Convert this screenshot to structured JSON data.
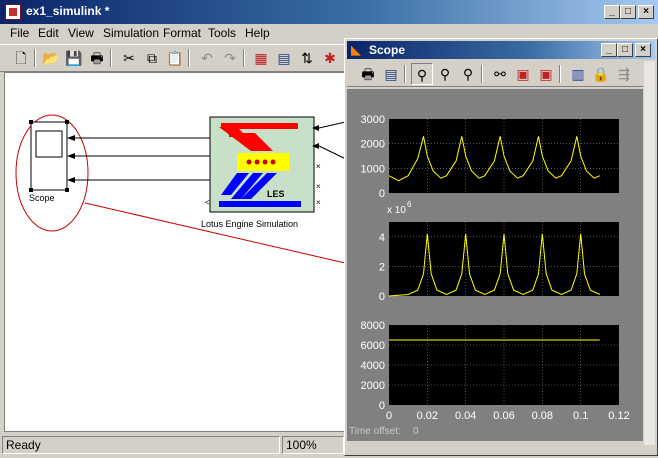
{
  "main_window": {
    "title": "ex1_simulink *",
    "menu": [
      "File",
      "Edit",
      "View",
      "Simulation",
      "Format",
      "Tools",
      "Help"
    ],
    "status": {
      "text": "Ready",
      "zoom": "100%"
    },
    "blocks": {
      "scope_label": "Scope",
      "les_badge": "LES",
      "les_label": "Lotus Engine Simulation"
    }
  },
  "scope_window": {
    "title": "Scope",
    "time_offset_label": "Time offset:",
    "time_offset_value": "0",
    "x_ticks": [
      "0",
      "0.02",
      "0.04",
      "0.06",
      "0.08",
      "0.1",
      "0.12"
    ]
  },
  "icons": {
    "main_toolbar": [
      "new-icon",
      "open-icon",
      "save-icon",
      "print-icon",
      "cut-icon",
      "copy-icon",
      "paste-icon",
      "undo-icon",
      "redo-icon",
      "library-browser-icon",
      "model-browser-icon",
      "start-icon",
      "debug-icon"
    ],
    "scope_toolbar": [
      "print-icon",
      "parameters-icon",
      "zoom-icon",
      "zoom-x-icon",
      "zoom-y-icon",
      "autoscale-icon",
      "save-axes-icon",
      "restore-axes-icon",
      "floating-scope-icon",
      "lock-axes-icon",
      "signal-selector-icon"
    ]
  },
  "colors": {
    "trace": "#ffff00",
    "plot_bg": "#000000",
    "scope_bg": "#808080",
    "title_bar": "#0a246a"
  },
  "chart_data": [
    {
      "type": "line",
      "y_ticks": [
        "0",
        "1000",
        "2000",
        "3000"
      ],
      "ylim": [
        0,
        3000
      ],
      "xlim": [
        0,
        0.12
      ],
      "grid": true,
      "series": [
        {
          "values_description_free": true,
          "x": [
            0,
            0.005,
            0.01,
            0.015,
            0.018,
            0.02,
            0.023,
            0.027,
            0.03,
            0.035,
            0.038,
            0.04,
            0.043,
            0.047,
            0.05,
            0.055,
            0.058,
            0.06,
            0.063,
            0.067,
            0.07,
            0.075,
            0.078,
            0.08,
            0.083,
            0.087,
            0.09,
            0.095,
            0.098,
            0.1,
            0.103,
            0.107,
            0.11
          ],
          "y": [
            700,
            500,
            700,
            1400,
            2300,
            1500,
            900,
            600,
            700,
            1300,
            2300,
            1500,
            900,
            600,
            700,
            1300,
            2300,
            1500,
            900,
            600,
            700,
            1300,
            2300,
            1500,
            900,
            600,
            700,
            1300,
            2300,
            1500,
            900,
            600,
            700
          ]
        }
      ]
    },
    {
      "type": "line",
      "exponent_label": "x 10",
      "exponent_power": "6",
      "y_ticks": [
        "0",
        "2",
        "4"
      ],
      "ylim": [
        0,
        5
      ],
      "xlim": [
        0,
        0.12
      ],
      "grid": true,
      "series": [
        {
          "x": [
            0,
            0.01,
            0.015,
            0.018,
            0.02,
            0.022,
            0.025,
            0.03,
            0.035,
            0.038,
            0.04,
            0.042,
            0.045,
            0.05,
            0.055,
            0.058,
            0.06,
            0.062,
            0.065,
            0.07,
            0.075,
            0.078,
            0.08,
            0.082,
            0.085,
            0.09,
            0.095,
            0.098,
            0.1,
            0.102,
            0.105,
            0.11
          ],
          "y": [
            0,
            0.1,
            0.4,
            1.5,
            4.2,
            1.5,
            0.4,
            0.1,
            0.4,
            1.5,
            4.2,
            1.5,
            0.4,
            0.1,
            0.4,
            1.5,
            4.2,
            1.5,
            0.4,
            0.1,
            0.4,
            1.5,
            4.2,
            1.5,
            0.4,
            0.1,
            0.4,
            1.5,
            4.2,
            1.5,
            0.4,
            0.1
          ]
        }
      ]
    },
    {
      "type": "line",
      "y_ticks": [
        "0",
        "2000",
        "4000",
        "6000",
        "8000"
      ],
      "ylim": [
        0,
        8000
      ],
      "xlim": [
        0,
        0.12
      ],
      "grid": true,
      "series": [
        {
          "x": [
            0,
            0.11
          ],
          "y": [
            6500,
            6500
          ]
        }
      ]
    }
  ]
}
